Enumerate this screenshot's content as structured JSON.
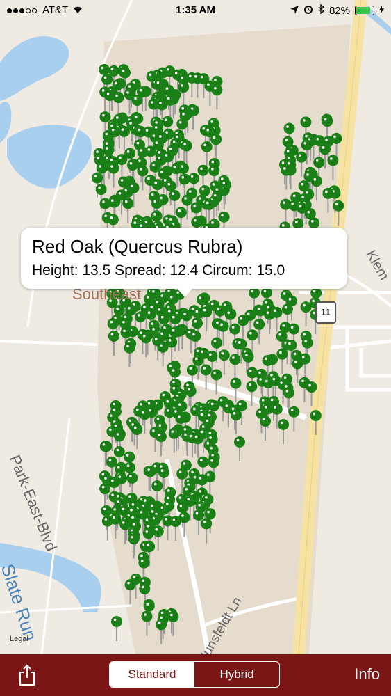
{
  "status_bar": {
    "carrier": "AT&T",
    "time": "1:35 AM",
    "battery_percent": "82%",
    "battery_level": 0.82
  },
  "map": {
    "labels": {
      "park_east_blvd": "Park-East-Blvd",
      "slate_run": "Slate Run",
      "street_ln": "Hunsfeldt Ln",
      "kleman": "Klem",
      "area": "Southeast",
      "route": "11",
      "legal": "Legal"
    },
    "colors": {
      "land": "#efebe3",
      "water": "#a8cfee",
      "campus": "#e5dccd",
      "road": "#ffffff",
      "highway": "#f6e3a3",
      "pin": "#1a7f16"
    }
  },
  "callout": {
    "title": "Red Oak (Quercus Rubra)",
    "details": "Height: 13.5 Spread: 12.4 Circum: 15.0"
  },
  "toolbar": {
    "share_icon": "share-icon",
    "segment_standard": "Standard",
    "segment_hybrid": "Hybrid",
    "selected_segment": "Standard",
    "info_label": "Info"
  }
}
